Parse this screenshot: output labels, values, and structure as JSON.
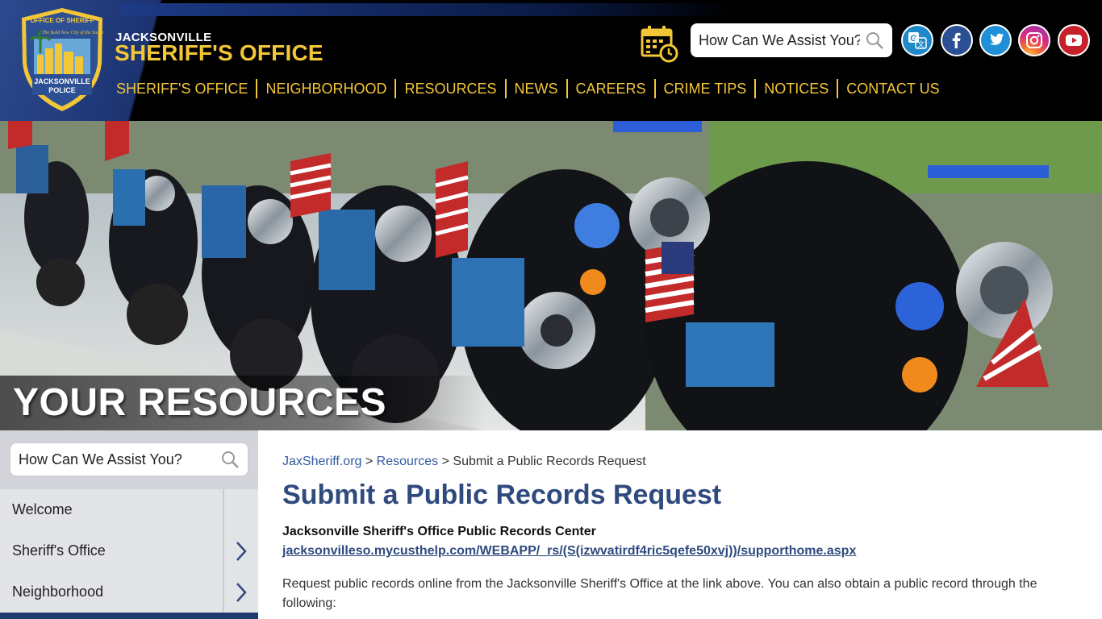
{
  "header": {
    "badge": {
      "top_text": "OFFICE OF SHERIFF",
      "motto": "The Bold New City of the South",
      "bottom_text": "JACKSONVILLE POLICE"
    },
    "brand_small": "JACKSONVILLE",
    "brand_big": "SHERIFF'S OFFICE",
    "nav": [
      "SHERIFF'S OFFICE",
      "NEIGHBORHOOD",
      "RESOURCES",
      "NEWS",
      "CAREERS",
      "CRIME TIPS",
      "NOTICES",
      "CONTACT US"
    ],
    "search_placeholder": "How Can We Assist You?",
    "icons": [
      "calendar-clock-icon",
      "translate-icon",
      "facebook-icon",
      "twitter-icon",
      "instagram-icon",
      "youtube-icon"
    ],
    "colors": {
      "gold": "#f3c638",
      "navy": "#1c3370"
    }
  },
  "hero": {
    "title": "YOUR RESOURCES"
  },
  "sidebar": {
    "search_placeholder": "How Can We Assist You?",
    "items": [
      {
        "label": "Welcome",
        "has_arrow": false
      },
      {
        "label": "Sheriff's Office",
        "has_arrow": true
      },
      {
        "label": "Neighborhood",
        "has_arrow": true
      }
    ]
  },
  "main": {
    "breadcrumb": {
      "home": "JaxSheriff.org",
      "sep1": ">",
      "section": "Resources",
      "sep2": ">",
      "current": "Submit a Public Records Request"
    },
    "title": "Submit a Public Records Request",
    "center_title": "Jacksonville Sheriff's Office Public Records Center",
    "center_link": "jacksonvilleso.mycusthelp.com/WEBAPP/_rs/(S(izwvatirdf4ric5qefe50xvj))/supporthome.aspx",
    "body": "Request public records online from the Jacksonville Sheriff's Office at the link above. You can also obtain a public record through the following:"
  }
}
